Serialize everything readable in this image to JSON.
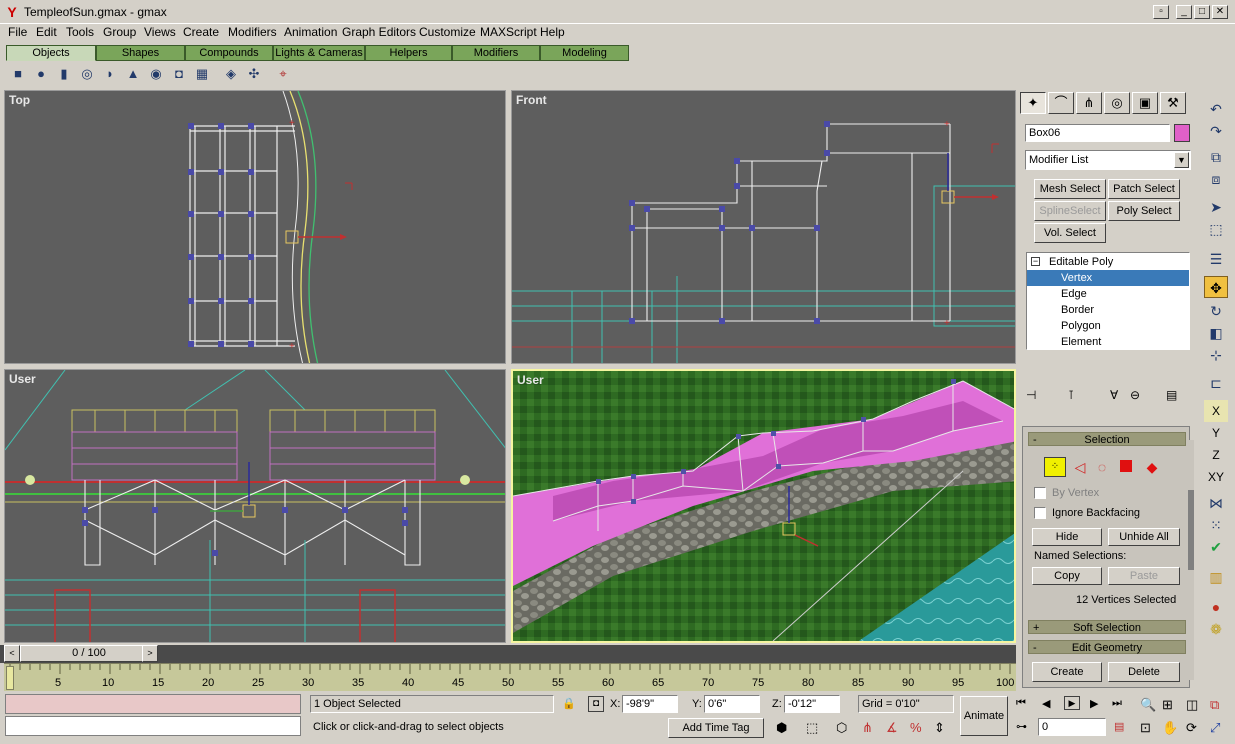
{
  "window": {
    "title": "TempleofSun.gmax - gmax"
  },
  "menu": [
    "File",
    "Edit",
    "Tools",
    "Group",
    "Views",
    "Create",
    "Modifiers",
    "Animation",
    "Graph Editors",
    "Customize",
    "MAXScript",
    "Help"
  ],
  "tabs": [
    "Objects",
    "Shapes",
    "Compounds",
    "Lights & Cameras",
    "Helpers",
    "Modifiers",
    "Modeling"
  ],
  "viewports": {
    "top": "Top",
    "front": "Front",
    "user1": "User",
    "user2": "User"
  },
  "command_panel": {
    "object_name": "Box06",
    "object_color": "#e060c8",
    "modifier_list": "Modifier List",
    "buttons": {
      "mesh_select": "Mesh Select",
      "patch_select": "Patch Select",
      "spline_select": "SplineSelect",
      "poly_select": "Poly Select",
      "vol_select": "Vol. Select"
    },
    "stack": [
      "Editable Poly",
      "Vertex",
      "Edge",
      "Border",
      "Polygon",
      "Element"
    ],
    "selection": {
      "title": "Selection",
      "by_vertex": "By Vertex",
      "ignore_backfacing": "Ignore Backfacing",
      "hide": "Hide",
      "unhide_all": "Unhide All",
      "named_selections": "Named Selections:",
      "copy": "Copy",
      "paste": "Paste",
      "status": "12 Vertices Selected"
    },
    "soft_selection": "Soft Selection",
    "edit_geometry": "Edit Geometry",
    "create": "Create",
    "delete": "Delete"
  },
  "right_toolbar": {
    "x": "X",
    "y": "Y",
    "z": "Z",
    "xy": "XY"
  },
  "time": {
    "slider": "0 / 100",
    "ticks": [
      "5",
      "10",
      "15",
      "20",
      "25",
      "30",
      "35",
      "40",
      "45",
      "50",
      "55",
      "60",
      "65",
      "70",
      "75",
      "80",
      "85",
      "90",
      "95",
      "100"
    ]
  },
  "status": {
    "selected": "1 Object Selected",
    "prompt": "Click or click-and-drag to select objects",
    "x_label": "X:",
    "x_value": "-98'9\"",
    "y_label": "Y:",
    "y_value": "0'6\"",
    "z_label": "Z:",
    "z_value": "-0'12\"",
    "grid": "Grid = 0'10\"",
    "add_time_tag": "Add Time Tag",
    "animate": "Animate",
    "frame": "0"
  },
  "colors": {
    "accent": "#e060c8",
    "tab_green": "#7aa55a",
    "viewport_bg": "#5e5e5e",
    "selection_blue": "#3a7ab8"
  }
}
